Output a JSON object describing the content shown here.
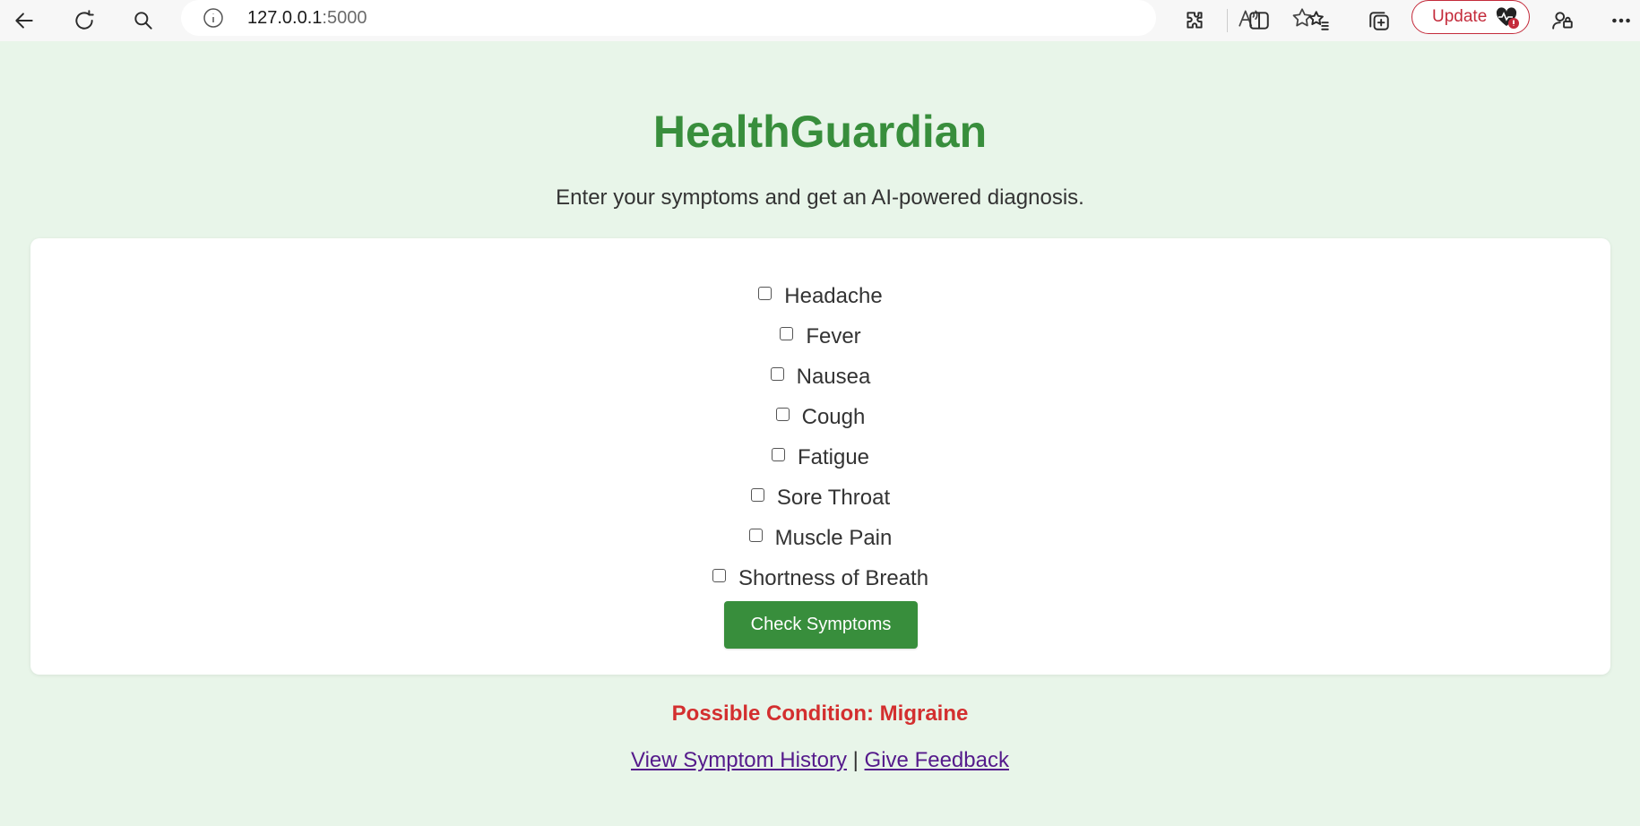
{
  "browser": {
    "url_host": "127.0.0.1",
    "url_port": ":5000",
    "update_label": "Update",
    "icons": [
      "back-icon",
      "refresh-icon",
      "search-icon",
      "info-icon",
      "read-aloud-icon",
      "favorite-star-icon",
      "extensions-icon",
      "split-screen-icon",
      "favorites-icon",
      "collections-icon",
      "health-alert-icon",
      "profile-icon",
      "more-icon"
    ]
  },
  "page": {
    "title": "HealthGuardian",
    "subtitle": "Enter your symptoms and get an AI-powered diagnosis."
  },
  "symptoms": [
    {
      "label": "Headache",
      "checked": false
    },
    {
      "label": "Fever",
      "checked": false
    },
    {
      "label": "Nausea",
      "checked": false
    },
    {
      "label": "Cough",
      "checked": false
    },
    {
      "label": "Fatigue",
      "checked": false
    },
    {
      "label": "Sore Throat",
      "checked": false
    },
    {
      "label": "Muscle Pain",
      "checked": false
    },
    {
      "label": "Shortness of Breath",
      "checked": false
    }
  ],
  "form": {
    "submit_label": "Check Symptoms"
  },
  "result": {
    "text": "Possible Condition: Migraine"
  },
  "links": {
    "history_label": "View Symptom History",
    "separator": "|",
    "feedback_label": "Give Feedback"
  },
  "colors": {
    "background": "#e8f5e9",
    "title": "#388e3c",
    "button": "#388e3c",
    "result": "#d32f2f",
    "link": "#551a8b"
  }
}
